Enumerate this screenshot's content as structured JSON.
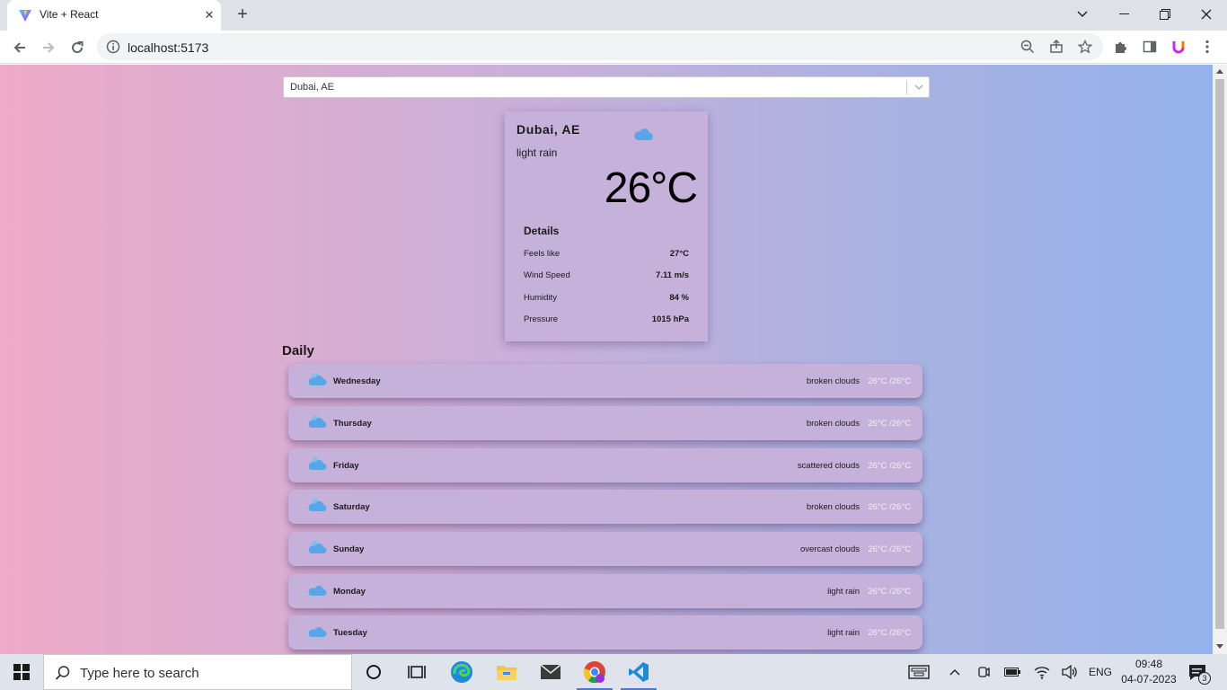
{
  "browser": {
    "tab_title": "Vite + React",
    "tab_close": "✕",
    "new_tab": "+",
    "url": "localhost:5173",
    "window_controls": {
      "minimize": "—",
      "maximize": "❐",
      "close": "✕",
      "tab_search": "⌄"
    }
  },
  "app": {
    "search": {
      "value": "Dubai, AE"
    },
    "current": {
      "city": "Dubai, AE",
      "description": "light rain",
      "temperature": "26°C",
      "icon": "cloud-icon",
      "details_title": "Details",
      "details": [
        {
          "label": "Feels like",
          "value": "27°C"
        },
        {
          "label": "Wind Speed",
          "value": "7.11 m/s"
        },
        {
          "label": "Humidity",
          "value": "84 %"
        },
        {
          "label": "Pressure",
          "value": "1015 hPa"
        }
      ]
    },
    "daily_title": "Daily",
    "daily": [
      {
        "day": "Wednesday",
        "description": "broken clouds",
        "temp": "26°C /26°C",
        "icon": "sun-cloud-icon"
      },
      {
        "day": "Thursday",
        "description": "broken clouds",
        "temp": "26°C /26°C",
        "icon": "sun-cloud-icon"
      },
      {
        "day": "Friday",
        "description": "scattered clouds",
        "temp": "26°C /26°C",
        "icon": "sun-cloud-icon"
      },
      {
        "day": "Saturday",
        "description": "broken clouds",
        "temp": "26°C /26°C",
        "icon": "sun-cloud-icon"
      },
      {
        "day": "Sunday",
        "description": "overcast clouds",
        "temp": "26°C /26°C",
        "icon": "sun-cloud-icon"
      },
      {
        "day": "Monday",
        "description": "light rain",
        "temp": "26°C /26°C",
        "icon": "cloud-icon"
      },
      {
        "day": "Tuesday",
        "description": "light rain",
        "temp": "26°C /26°C",
        "icon": "cloud-icon"
      }
    ]
  },
  "taskbar": {
    "search_placeholder": "Type here to search",
    "language": "ENG",
    "time": "09:48",
    "date": "04-07-2023",
    "notification_count": "3"
  },
  "colors": {
    "gradient_left": "#eeaac8",
    "gradient_right": "#94b2ec",
    "card": "#c5b1da",
    "icon_blue": "#58a6e8"
  }
}
